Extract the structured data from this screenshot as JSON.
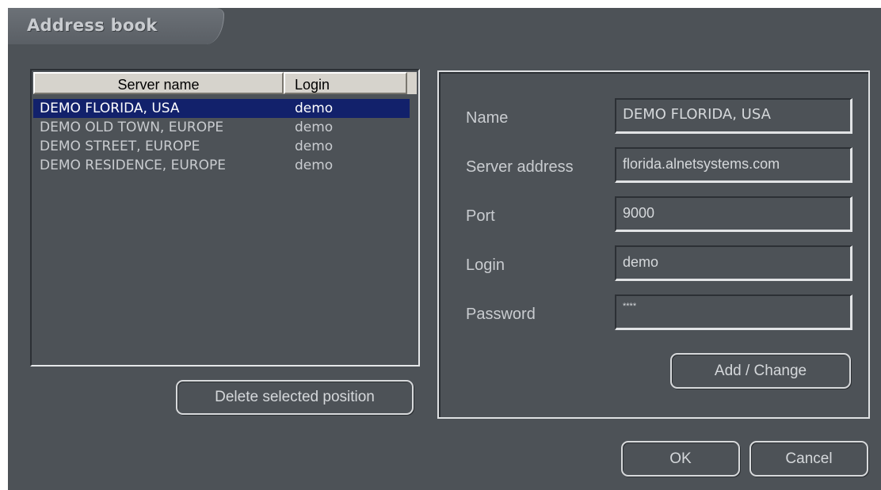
{
  "window": {
    "title": "Address book"
  },
  "list": {
    "columns": {
      "server": "Server name",
      "login": "Login"
    },
    "rows": [
      {
        "server": "DEMO FLORIDA, USA",
        "login": "demo",
        "selected": true
      },
      {
        "server": "DEMO OLD TOWN, EUROPE",
        "login": "demo",
        "selected": false
      },
      {
        "server": "DEMO STREET, EUROPE",
        "login": "demo",
        "selected": false
      },
      {
        "server": "DEMO RESIDENCE, EUROPE",
        "login": "demo",
        "selected": false
      }
    ],
    "delete_label": "Delete selected position"
  },
  "details": {
    "name_label": "Name",
    "name_value": "DEMO FLORIDA, USA",
    "address_label": "Server address",
    "address_value": "florida.alnetsystems.com",
    "port_label": "Port",
    "port_value": "9000",
    "login_label": "Login",
    "login_value": "demo",
    "password_label": "Password",
    "password_value": "****",
    "add_label": "Add / Change"
  },
  "footer": {
    "ok_label": "OK",
    "cancel_label": "Cancel"
  },
  "colors": {
    "background": "#4d5257",
    "selection": "#12216b",
    "text": "#c9ccd0",
    "header": "#d6d3cc"
  }
}
